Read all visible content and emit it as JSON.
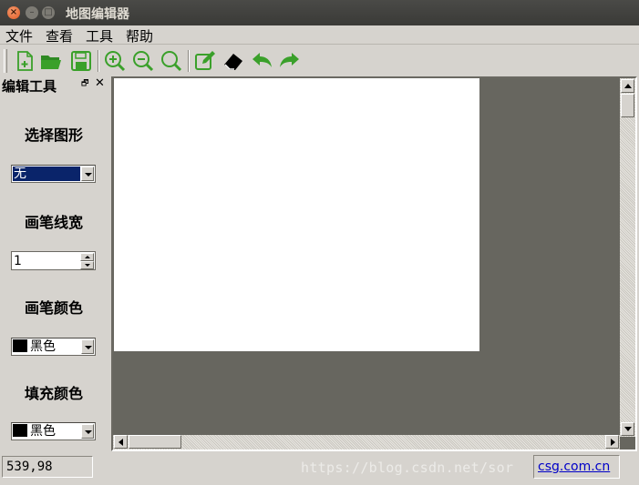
{
  "window": {
    "title": "地图编辑器"
  },
  "menu": [
    "文件",
    "查看",
    "工具",
    "帮助"
  ],
  "toolbar": {
    "icons": [
      "new-file-icon",
      "open-folder-icon",
      "save-icon",
      "zoom-in-icon",
      "zoom-out-icon",
      "zoom-reset-icon",
      "edit-icon",
      "eraser-icon",
      "undo-icon",
      "redo-icon"
    ],
    "accent": "#3aa02a"
  },
  "dock": {
    "title": "编辑工具",
    "float_glyph": "🗗",
    "close_glyph": "✕",
    "shape_label": "选择图形",
    "shape_value": "无",
    "width_label": "画笔线宽",
    "width_value": "1",
    "pen_color_label": "画笔颜色",
    "pen_color_value": "黑色",
    "fill_color_label": "填充颜色",
    "fill_color_value": "黑色"
  },
  "status": {
    "coords": "539,98",
    "watermark": "https://blog.csdn.net/sor",
    "link": "csg.com.cn"
  },
  "colors": {
    "titlebar": "#3c3b37",
    "selection": "#0a246a",
    "canvas_bg": "#67665f",
    "paper": "#ffffff"
  }
}
